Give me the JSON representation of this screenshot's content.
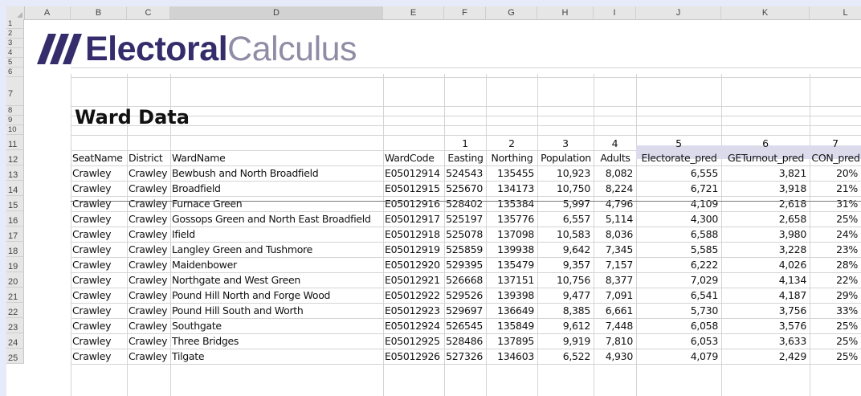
{
  "columns": [
    "A",
    "B",
    "C",
    "D",
    "E",
    "F",
    "G",
    "H",
    "I",
    "J",
    "K",
    "L"
  ],
  "rows": [
    "1",
    "2",
    "3",
    "4",
    "5",
    "6",
    "7",
    "8",
    "9",
    "10",
    "11",
    "12",
    "13",
    "14",
    "15",
    "16",
    "17",
    "18",
    "19",
    "20",
    "21",
    "22",
    "23",
    "24",
    "25"
  ],
  "logo": {
    "part1": "Electoral",
    "part2": "Calculus",
    "icon": "triple-slash-logo-icon"
  },
  "title": "Ward Data",
  "index_row": [
    "1",
    "2",
    "3",
    "4",
    "5",
    "6",
    "7"
  ],
  "headers": [
    "SeatName",
    "District",
    "WardName",
    "WardCode",
    "Easting",
    "Northing",
    "Population",
    "Adults",
    "Electorate_pred",
    "GETurnout_pred",
    "CON_pred"
  ],
  "data_rows": [
    [
      "Crawley",
      "Crawley",
      "Bewbush and North Broadfield",
      "E05012914",
      "524543",
      "135455",
      "10,923",
      "8,082",
      "6,555",
      "3,821",
      "20%"
    ],
    [
      "Crawley",
      "Crawley",
      "Broadfield",
      "E05012915",
      "525670",
      "134173",
      "10,750",
      "8,224",
      "6,721",
      "3,918",
      "21%"
    ],
    [
      "Crawley",
      "Crawley",
      "Furnace Green",
      "E05012916",
      "528402",
      "135384",
      "5,997",
      "4,796",
      "4,109",
      "2,618",
      "31%"
    ],
    [
      "Crawley",
      "Crawley",
      "Gossops Green and North East Broadfield",
      "E05012917",
      "525197",
      "135776",
      "6,557",
      "5,114",
      "4,300",
      "2,658",
      "25%"
    ],
    [
      "Crawley",
      "Crawley",
      "Ifield",
      "E05012918",
      "525078",
      "137098",
      "10,583",
      "8,036",
      "6,588",
      "3,980",
      "24%"
    ],
    [
      "Crawley",
      "Crawley",
      "Langley Green and Tushmore",
      "E05012919",
      "525859",
      "139938",
      "9,642",
      "7,345",
      "5,585",
      "3,228",
      "23%"
    ],
    [
      "Crawley",
      "Crawley",
      "Maidenbower",
      "E05012920",
      "529395",
      "135479",
      "9,357",
      "7,157",
      "6,222",
      "4,026",
      "28%"
    ],
    [
      "Crawley",
      "Crawley",
      "Northgate and West Green",
      "E05012921",
      "526668",
      "137151",
      "10,756",
      "8,377",
      "7,029",
      "4,134",
      "22%"
    ],
    [
      "Crawley",
      "Crawley",
      "Pound Hill North and Forge Wood",
      "E05012922",
      "529526",
      "139398",
      "9,477",
      "7,091",
      "6,541",
      "4,187",
      "29%"
    ],
    [
      "Crawley",
      "Crawley",
      "Pound Hill South and Worth",
      "E05012923",
      "529697",
      "136649",
      "8,385",
      "6,661",
      "5,730",
      "3,756",
      "33%"
    ],
    [
      "Crawley",
      "Crawley",
      "Southgate",
      "E05012924",
      "526545",
      "135849",
      "9,612",
      "7,448",
      "6,058",
      "3,576",
      "25%"
    ],
    [
      "Crawley",
      "Crawley",
      "Three Bridges",
      "E05012925",
      "528486",
      "137895",
      "9,919",
      "7,810",
      "6,053",
      "3,633",
      "25%"
    ],
    [
      "Crawley",
      "Crawley",
      "Tilgate",
      "E05012926",
      "527326",
      "134603",
      "6,522",
      "4,930",
      "4,079",
      "2,429",
      "25%"
    ]
  ]
}
